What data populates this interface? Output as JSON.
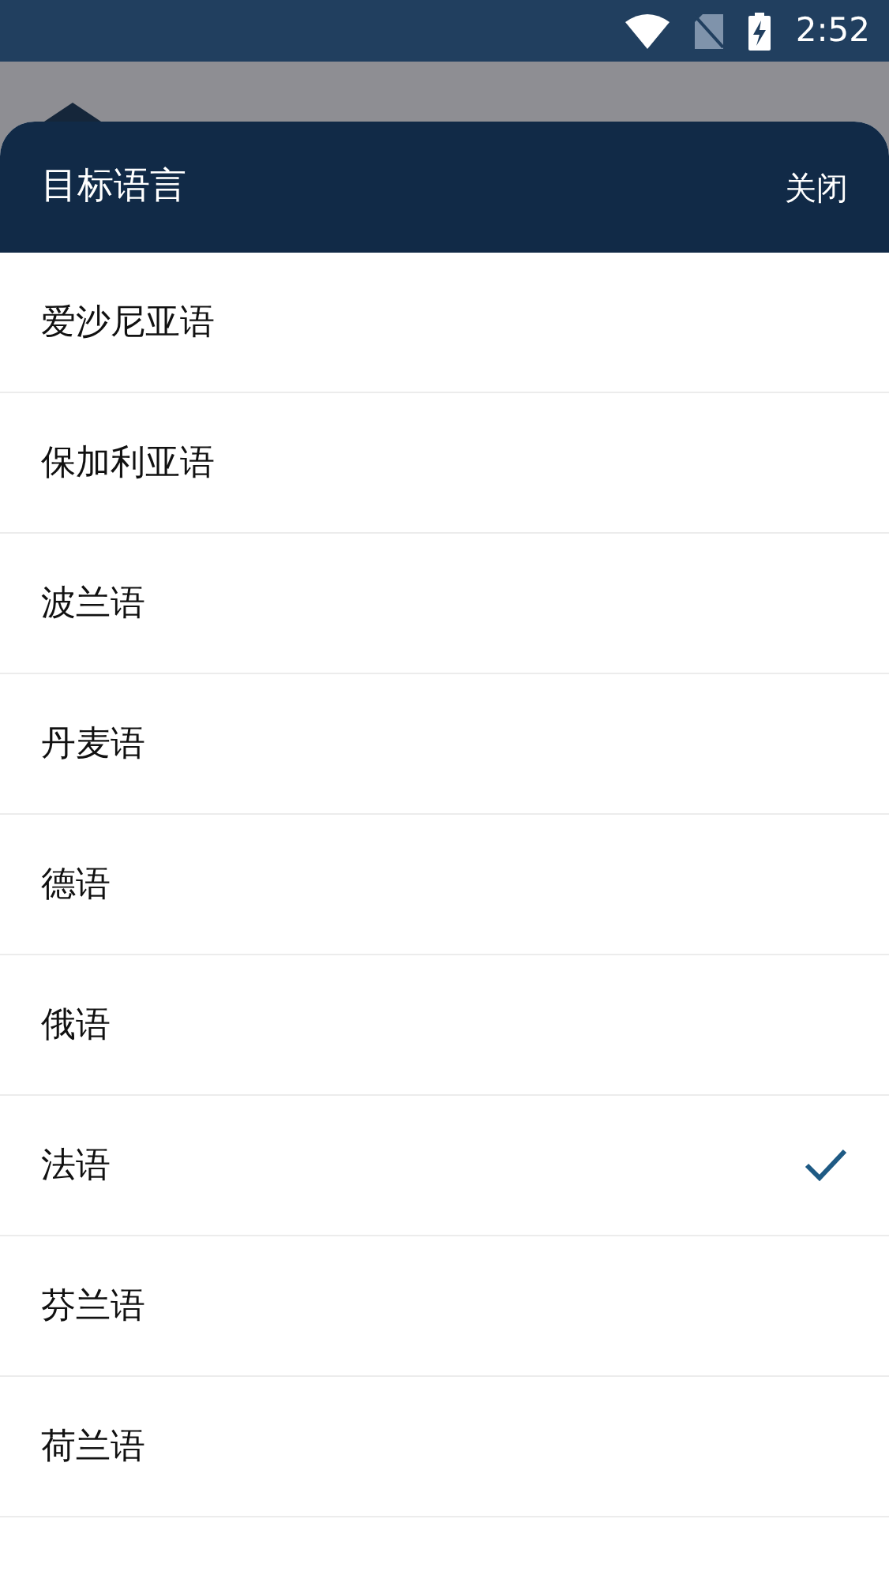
{
  "status_bar": {
    "time": "2:52"
  },
  "sheet": {
    "title": "目标语言",
    "close_label": "关闭"
  },
  "languages": [
    {
      "label": "爱沙尼亚语",
      "selected": false
    },
    {
      "label": "保加利亚语",
      "selected": false
    },
    {
      "label": "波兰语",
      "selected": false
    },
    {
      "label": "丹麦语",
      "selected": false
    },
    {
      "label": "德语",
      "selected": false
    },
    {
      "label": "俄语",
      "selected": false
    },
    {
      "label": "法语",
      "selected": true
    },
    {
      "label": "芬兰语",
      "selected": false
    },
    {
      "label": "荷兰语",
      "selected": false
    }
  ]
}
